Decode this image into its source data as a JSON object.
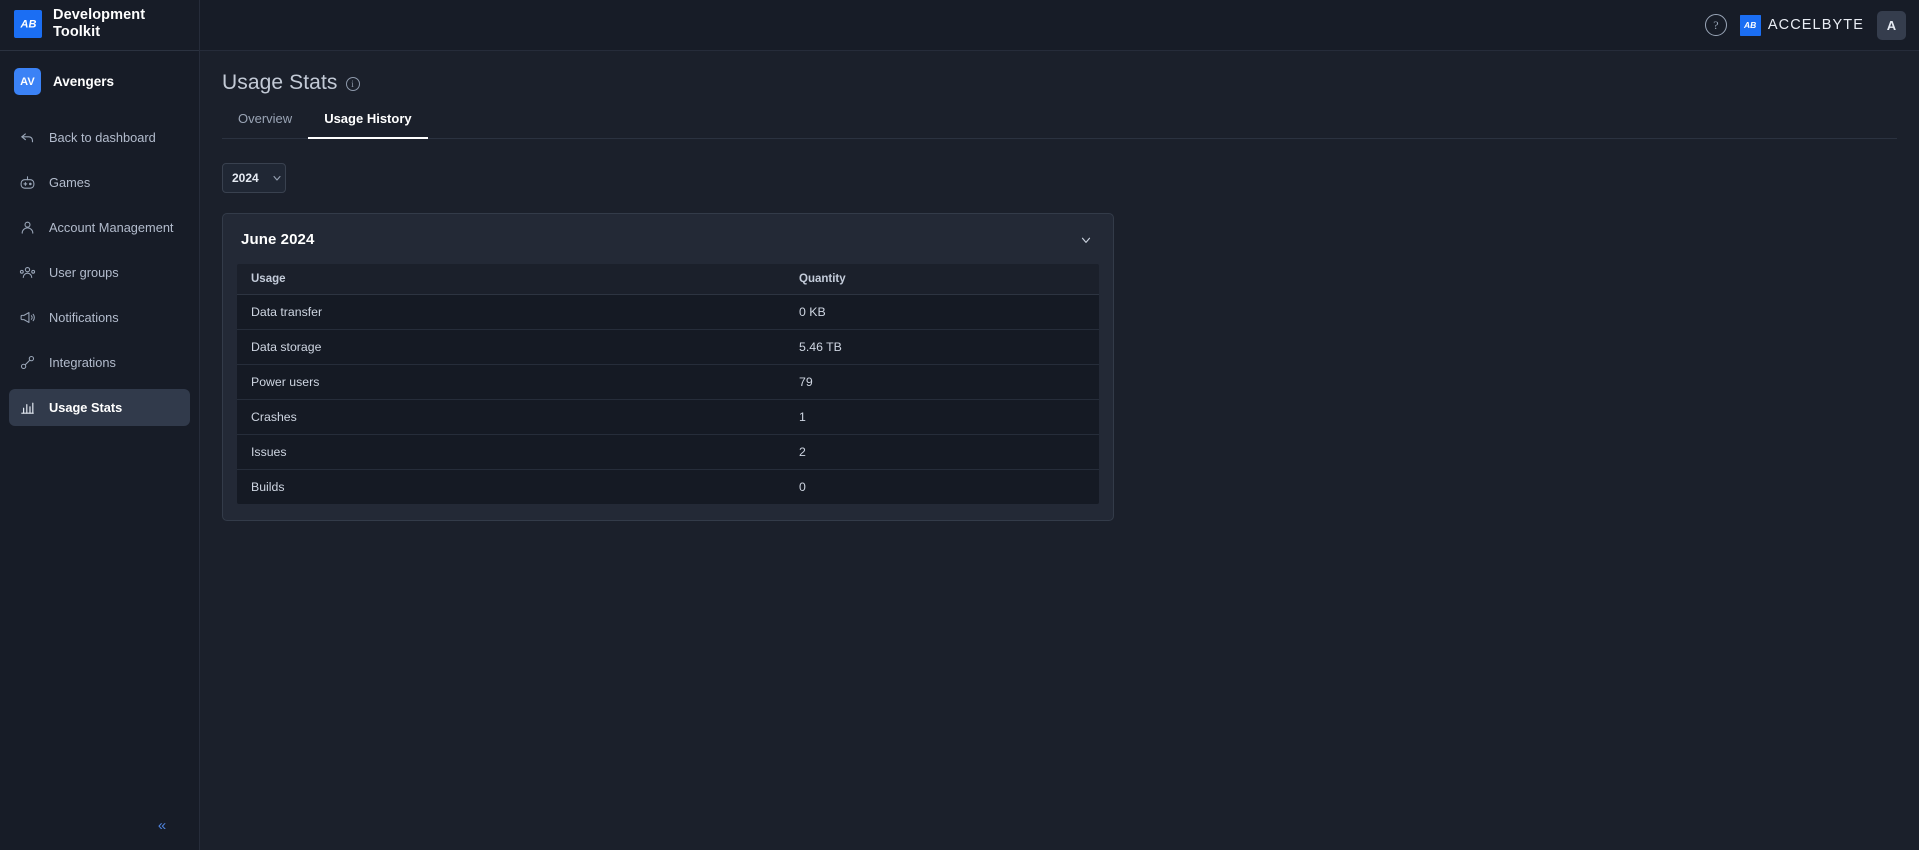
{
  "sidebar": {
    "brand": {
      "name": "Development Toolkit",
      "logo_icon": "accelbyte-logo-icon"
    },
    "org": {
      "initials": "AV",
      "name": "Avengers"
    },
    "items": [
      {
        "label": "Back to dashboard",
        "icon": "back-arrow-icon",
        "active": false
      },
      {
        "label": "Games",
        "icon": "gamepad-icon",
        "active": false
      },
      {
        "label": "Account Management",
        "icon": "user-icon",
        "active": false
      },
      {
        "label": "User groups",
        "icon": "users-group-icon",
        "active": false
      },
      {
        "label": "Notifications",
        "icon": "megaphone-icon",
        "active": false
      },
      {
        "label": "Integrations",
        "icon": "plug-icon",
        "active": false
      },
      {
        "label": "Usage Stats",
        "icon": "bar-chart-icon",
        "active": true
      }
    ],
    "collapse": {
      "label": "«",
      "icon": "chevron-double-left-icon"
    }
  },
  "topbar": {
    "help_icon": "help-circle-icon",
    "help_label": "?",
    "brand_text": "ACCELBYTE",
    "brand_icon": "accelbyte-mark-icon",
    "avatar_initial": "A"
  },
  "page": {
    "title": "Usage Stats",
    "info_icon": "info-circle-icon",
    "info_label": "i",
    "tabs": [
      {
        "label": "Overview",
        "active": false
      },
      {
        "label": "Usage History",
        "active": true
      }
    ],
    "year_filter": {
      "value": "2024",
      "chevron_icon": "chevron-down-icon"
    }
  },
  "card": {
    "title": "June 2024",
    "chevron_icon": "chevron-down-icon",
    "table": {
      "columns": [
        "Usage",
        "Quantity"
      ],
      "rows": [
        {
          "usage": "Data transfer",
          "quantity": "0 KB"
        },
        {
          "usage": "Data storage",
          "quantity": "5.46 TB"
        },
        {
          "usage": "Power users",
          "quantity": "79"
        },
        {
          "usage": "Crashes",
          "quantity": "1"
        },
        {
          "usage": "Issues",
          "quantity": "2"
        },
        {
          "usage": "Builds",
          "quantity": "0"
        }
      ]
    }
  },
  "colors": {
    "accent_blue": "#1b6ef3",
    "org_badge": "#3b82f6",
    "sidebar_bg": "#171c27",
    "main_bg": "#1b202b",
    "card_bg": "#232936",
    "table_row_bg": "#151a24",
    "collapse_blue": "#4f83dd"
  }
}
